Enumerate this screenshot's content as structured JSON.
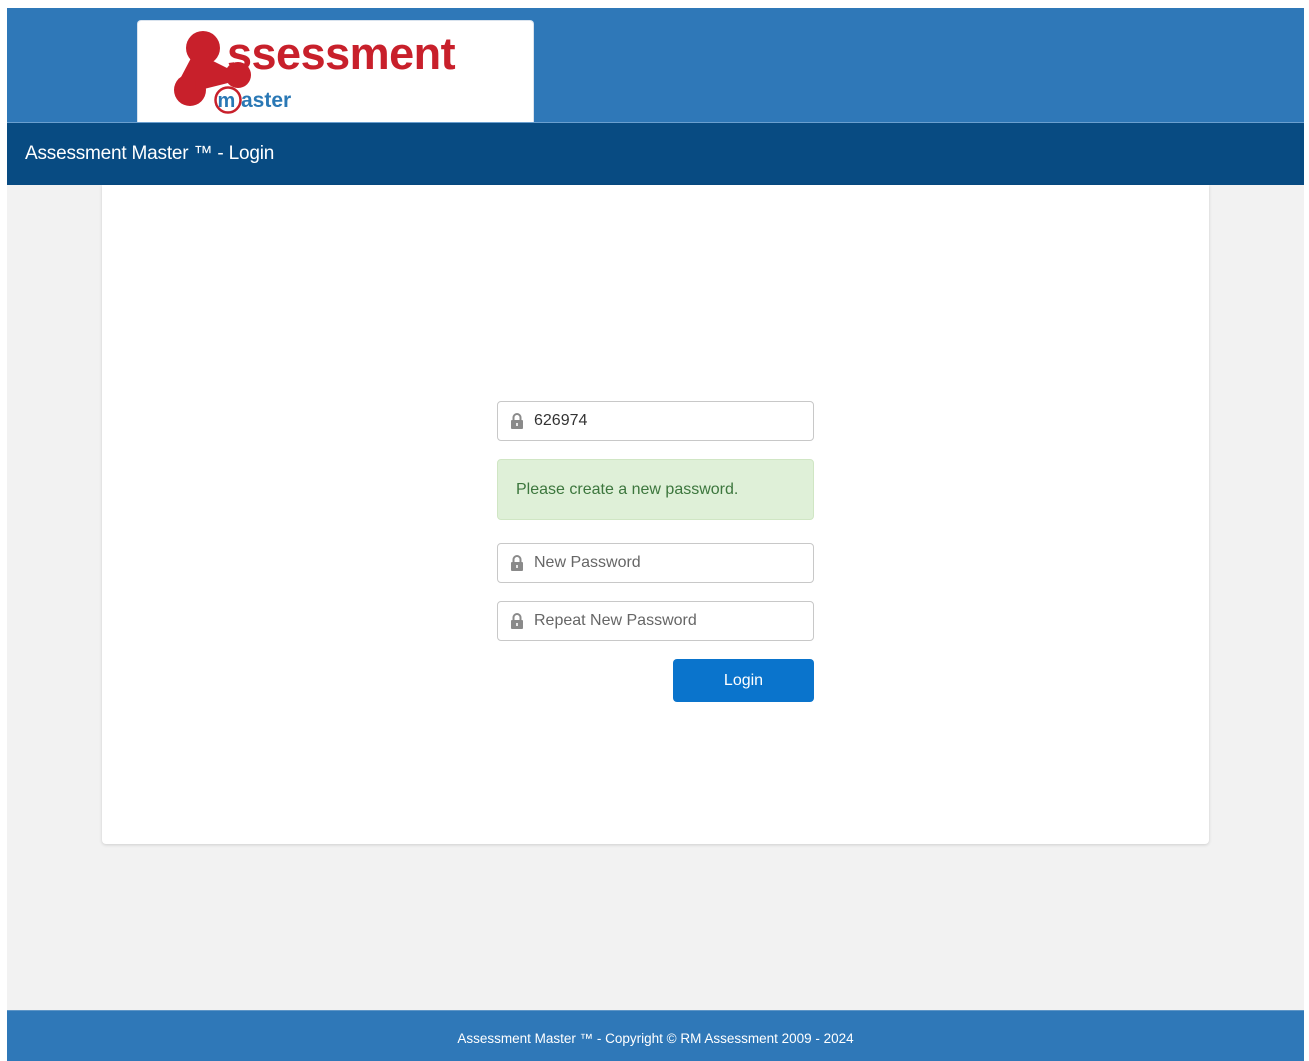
{
  "header": {
    "logo": {
      "initial": "A",
      "word": "ssessment",
      "sub_initial": "m",
      "sub_word": "aster",
      "brand_red": "#c8202b",
      "brand_blue": "#2a78b5"
    },
    "title": "Assessment Master ™ - Login"
  },
  "form": {
    "username": {
      "value": "626974",
      "icon": "lock-icon"
    },
    "alert_message": "Please create a new password.",
    "new_password": {
      "placeholder": "New Password",
      "icon": "lock-icon"
    },
    "repeat_password": {
      "placeholder": "Repeat New Password",
      "icon": "lock-icon"
    },
    "login_label": "Login"
  },
  "footer": {
    "copyright": "Assessment Master ™ - Copyright © RM Assessment 2009 - 2024"
  },
  "colors": {
    "topbar": "#2f78b8",
    "titlebar": "#084b82",
    "button": "#0a74cc",
    "alert_bg": "#dff0d8",
    "alert_text": "#3c763d"
  }
}
